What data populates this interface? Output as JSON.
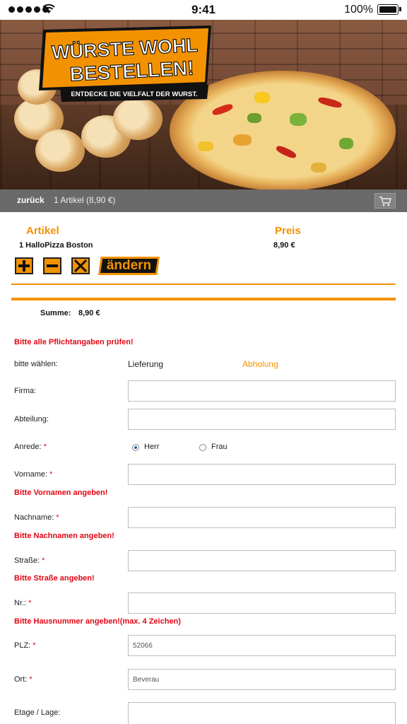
{
  "status_bar": {
    "time": "9:41",
    "battery": "100%",
    "battery_level": 1.0
  },
  "banner": {
    "headline_line1": "WÜRSTE WOHL",
    "headline_line2": "BESTELLEN!",
    "tagline": "ENTDECKE DIE VIELFALT DER WURST."
  },
  "nav": {
    "back": "zurück",
    "cart_summary": "1 Artikel (8,90 €)",
    "cart_icon": "cart-icon"
  },
  "order": {
    "col_article": "Artikel",
    "col_price": "Preis",
    "items": [
      {
        "name": "1 HalloPizza Boston",
        "price": "8,90 €"
      }
    ],
    "edit_label": "ändern",
    "sum_label": "Summe:",
    "sum_value": "8,90 €"
  },
  "colors": {
    "accent": "#f39200",
    "error": "#e30613",
    "navbar": "#6a6a6a"
  },
  "form": {
    "check_notice": "Bitte alle Pflichtangaben prüfen!",
    "choose_label": "bitte wählen:",
    "option_delivery": "Lieferung",
    "option_pickup": "Abholung",
    "company_label": "Firma:",
    "department_label": "Abteilung:",
    "salutation_label": "Anrede:",
    "salutation_mr": "Herr",
    "salutation_mrs": "Frau",
    "salutation_selected": "Herr",
    "firstname_label": "Vorname:",
    "firstname_error": "Bitte Vornamen angeben!",
    "lastname_label": "Nachname:",
    "lastname_error": "Bitte Nachnamen angeben!",
    "street_label": "Straße:",
    "street_error": "Bitte Straße angeben!",
    "number_label": "Nr.:",
    "number_error": "Bitte Hausnummer angeben!(max. 4 Zeichen)",
    "zip_label": "PLZ:",
    "zip_value": "52066",
    "city_label": "Ort:",
    "city_value": "Beverau",
    "floor_label": "Etage / Lage:",
    "required_mark": "*"
  }
}
